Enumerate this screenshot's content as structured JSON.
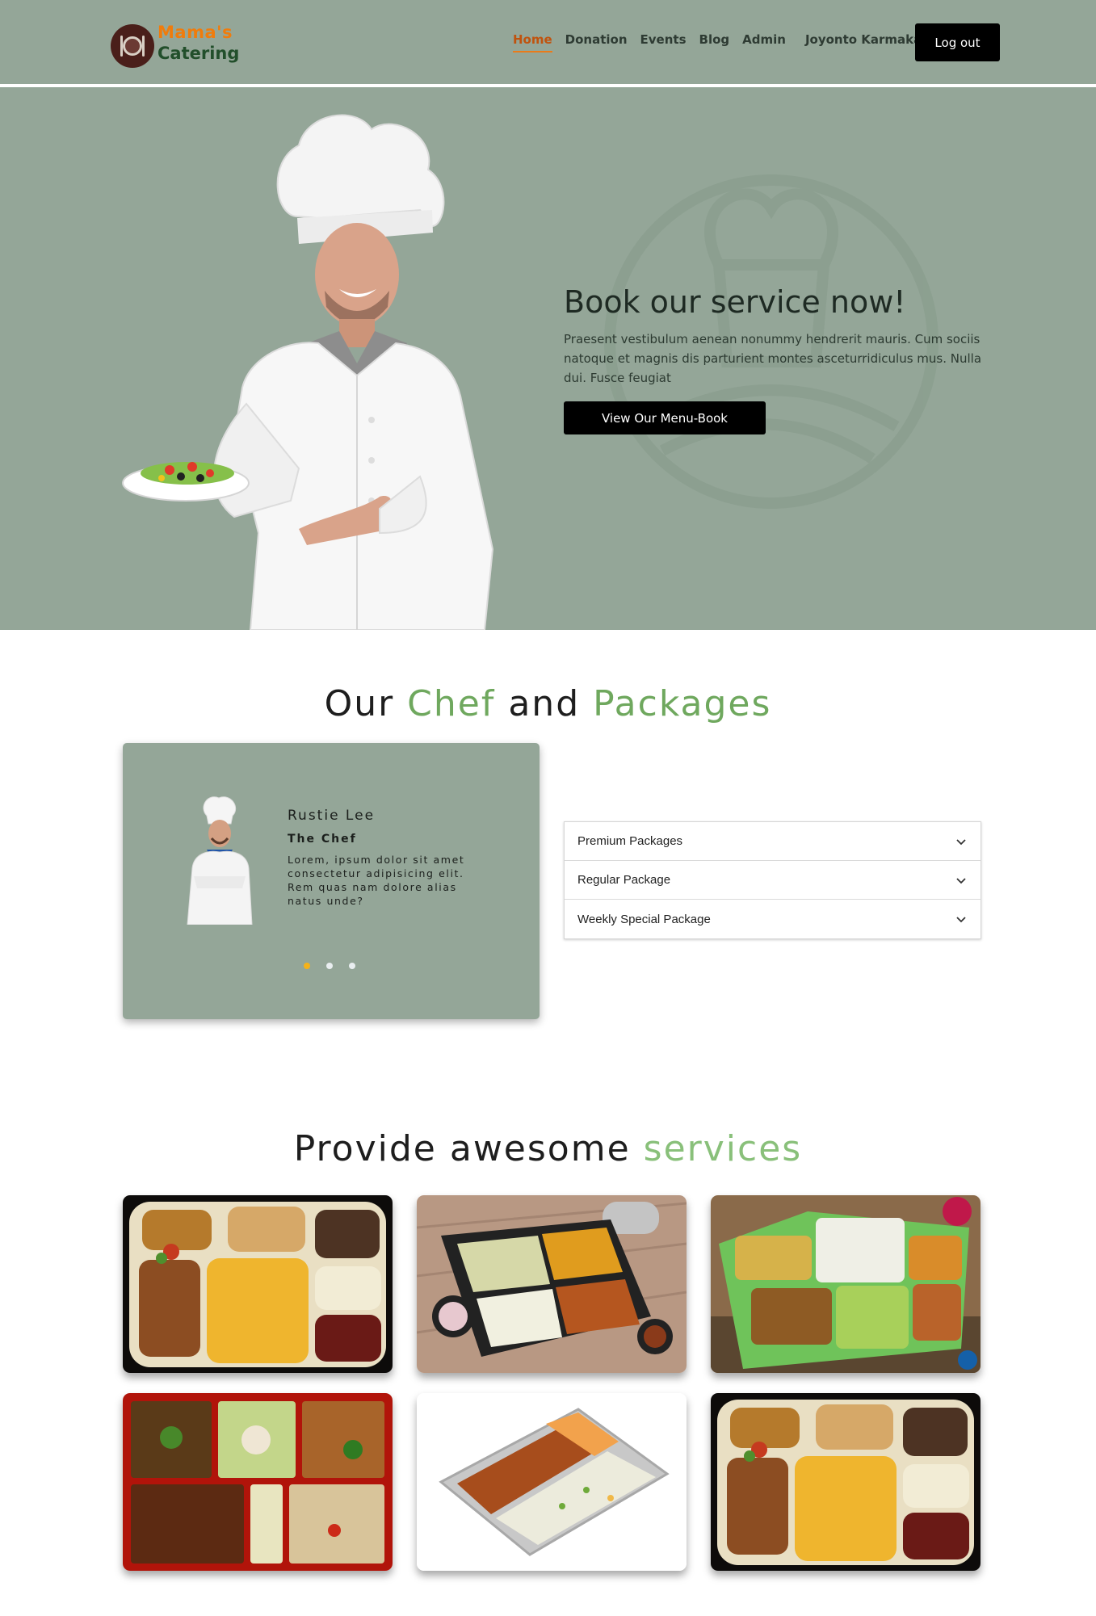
{
  "brand": {
    "line1": "Mama's",
    "line2": "Catering"
  },
  "nav": {
    "links": [
      "Home",
      "Donation",
      "Events",
      "Blog",
      "Admin"
    ],
    "user_name": "Joyonto Karmakar",
    "logout_label": "Log out"
  },
  "hero": {
    "title": "Book our service now!",
    "text": "Praesent vestibulum aenean nonummy hendrerit mauris. Cum sociis natoque et magnis dis parturient montes asceturridiculus mus. Nulla dui. Fusce feugiat",
    "button_label": "View Our Menu-Book"
  },
  "chef_section": {
    "title_parts": [
      "Our",
      "Chef",
      "and",
      "Packages"
    ],
    "chef": {
      "name": "Rustie Lee",
      "role": "The Chef",
      "description": "Lorem, ipsum dolor sit amet consectetur adipisicing elit. Rem quas nam dolore alias natus unde?"
    },
    "carousel_dots": 3,
    "active_dot": 1
  },
  "packages": [
    "Premium Packages",
    "Regular Package",
    "Weekly Special Package"
  ],
  "services_section": {
    "title_parts": [
      "Provide awesome",
      "services"
    ],
    "cards": [
      "biryani-thali-tray",
      "veg-rice-meal-box",
      "green-lunch-box",
      "red-bento-box",
      "foil-chicken-rice-tray",
      "biryani-thali-tray"
    ]
  },
  "colors": {
    "header_bg": "#94a698",
    "accent_orange": "#ea7b1a",
    "accent_green": "#6fa85e",
    "button_black": "#000000"
  }
}
